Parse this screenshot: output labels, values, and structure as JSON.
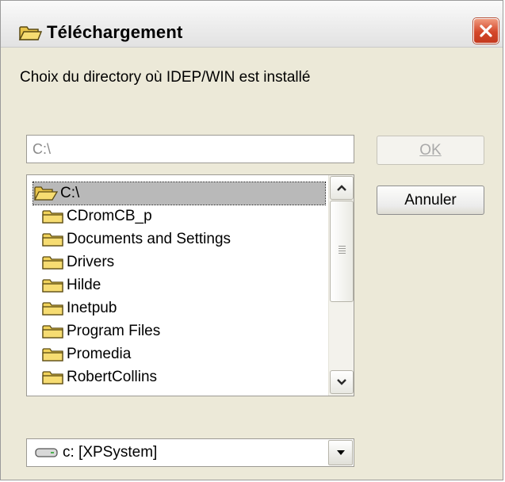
{
  "window": {
    "title": "Téléchargement",
    "close_icon": "close-icon"
  },
  "prompt": "Choix du directory où IDEP/WIN est installé",
  "path_input": {
    "value": "C:\\"
  },
  "buttons": {
    "ok_label": "OK",
    "cancel_label": "Annuler"
  },
  "folder_list": {
    "root": "C:\\",
    "folders": [
      "CDromCB_p",
      "Documents and Settings",
      "Drivers",
      "Hilde",
      "Inetpub",
      "Program Files",
      "Promedia",
      "RobertCollins"
    ]
  },
  "drive": {
    "label": "c: [XPSystem]"
  }
}
